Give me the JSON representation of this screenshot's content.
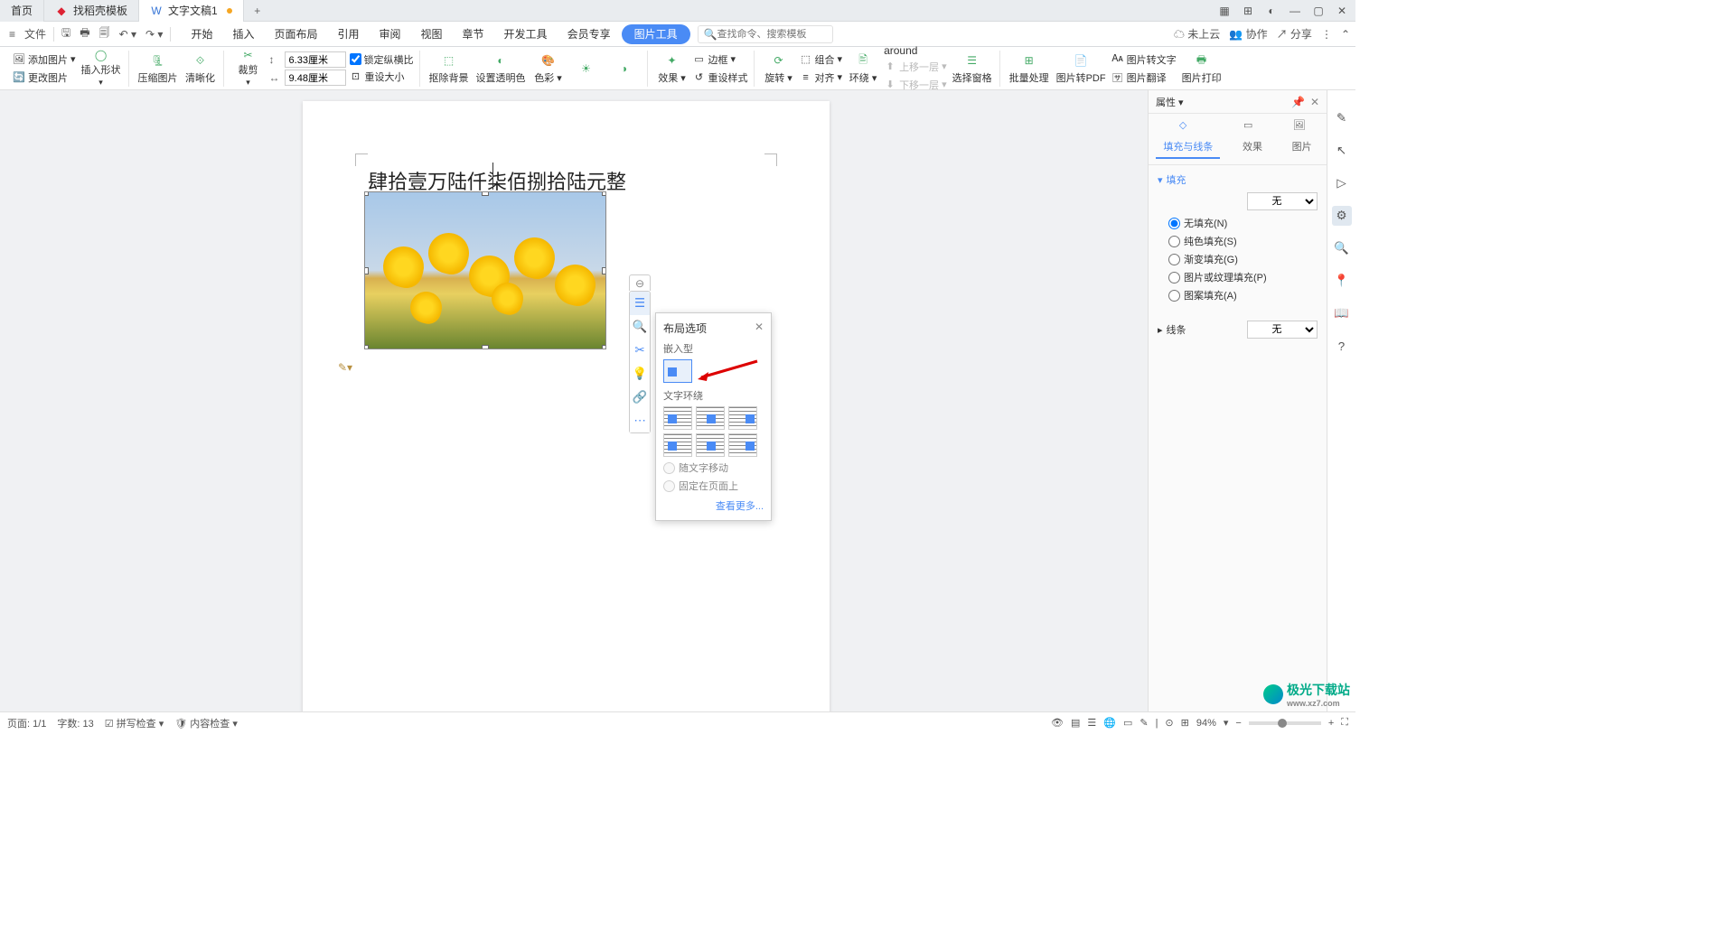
{
  "tabs": {
    "home": "首页",
    "tab1": "找稻壳模板",
    "tab2": "文字文稿1"
  },
  "menubar": {
    "file": "文件",
    "tabs": [
      "开始",
      "插入",
      "页面布局",
      "引用",
      "审阅",
      "视图",
      "章节",
      "开发工具",
      "会员专享",
      "图片工具"
    ],
    "search_placeholder": "查找命令、搜索模板",
    "cloud": "未上云",
    "coop": "协作",
    "share": "分享"
  },
  "ribbon": {
    "add_pic": "添加图片",
    "change_pic": "更改图片",
    "insert_shape": "插入形状",
    "compress": "压缩图片",
    "sharpen": "清晰化",
    "crop": "裁剪",
    "w": "6.33厘米",
    "h": "9.48厘米",
    "lock": "锁定纵横比",
    "reset_size": "重设大小",
    "remove_bg": "抠除背景",
    "transparency": "设置透明色",
    "color": "色彩",
    "effects": "效果",
    "reset_style": "重设样式",
    "rotate": "旋转",
    "group": "组合",
    "align": "对齐",
    "wrap": "环绕",
    "move_up": "上移一层",
    "move_down": "下移一层",
    "sel_pane": "选择窗格",
    "batch": "批量处理",
    "to_pdf": "图片转PDF",
    "to_text": "图片转文字",
    "translate": "图片翻译",
    "print": "图片打印",
    "border": "边框"
  },
  "doc": {
    "text": "肆拾壹万陆仟柒佰捌拾陆元整"
  },
  "layout_popup": {
    "title": "布局选项",
    "inline": "嵌入型",
    "wrap": "文字环绕",
    "with_text": "随文字移动",
    "fixed": "固定在页面上",
    "more": "查看更多..."
  },
  "prop": {
    "title": "属性",
    "tab_fill": "填充与线条",
    "tab_effect": "效果",
    "tab_pic": "图片",
    "fill_section": "填充",
    "none": "无",
    "no_fill": "无填充(N)",
    "solid": "纯色填充(S)",
    "gradient": "渐变填充(G)",
    "pic_fill": "图片或纹理填充(P)",
    "pattern": "图案填充(A)",
    "line_section": "线条"
  },
  "status": {
    "page": "页面: 1/1",
    "words": "字数: 13",
    "spell": "拼写检查",
    "content": "内容检查",
    "zoom": "94%"
  },
  "watermark": {
    "name": "极光下载站",
    "sub": "www.xz7.com"
  }
}
